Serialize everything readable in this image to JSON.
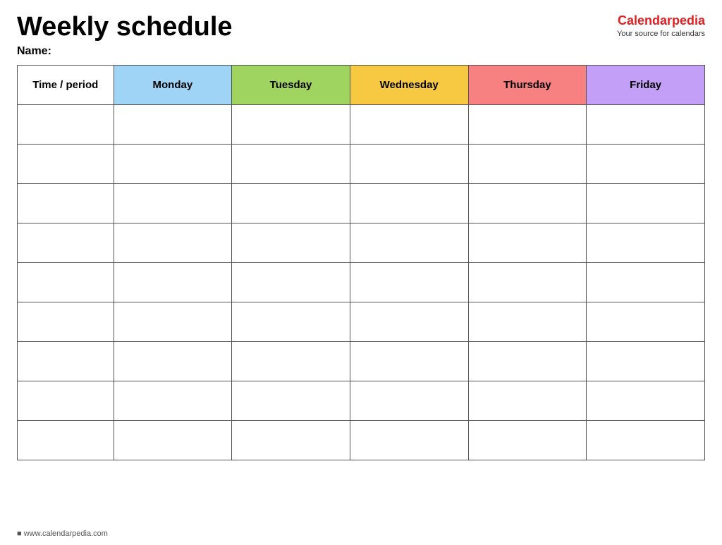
{
  "header": {
    "title": "Weekly schedule",
    "name_label": "Name:",
    "logo_text_part1": "Calendar",
    "logo_text_part2": "pedia",
    "logo_sub": "Your source for calendars"
  },
  "table": {
    "headers": [
      {
        "label": "Time / period",
        "class": "col-time"
      },
      {
        "label": "Monday",
        "class": "col-monday"
      },
      {
        "label": "Tuesday",
        "class": "col-tuesday"
      },
      {
        "label": "Wednesday",
        "class": "col-wednesday"
      },
      {
        "label": "Thursday",
        "class": "col-thursday"
      },
      {
        "label": "Friday",
        "class": "col-friday"
      }
    ],
    "rows": 9
  },
  "footer": {
    "url": "www.calendarpedia.com"
  }
}
